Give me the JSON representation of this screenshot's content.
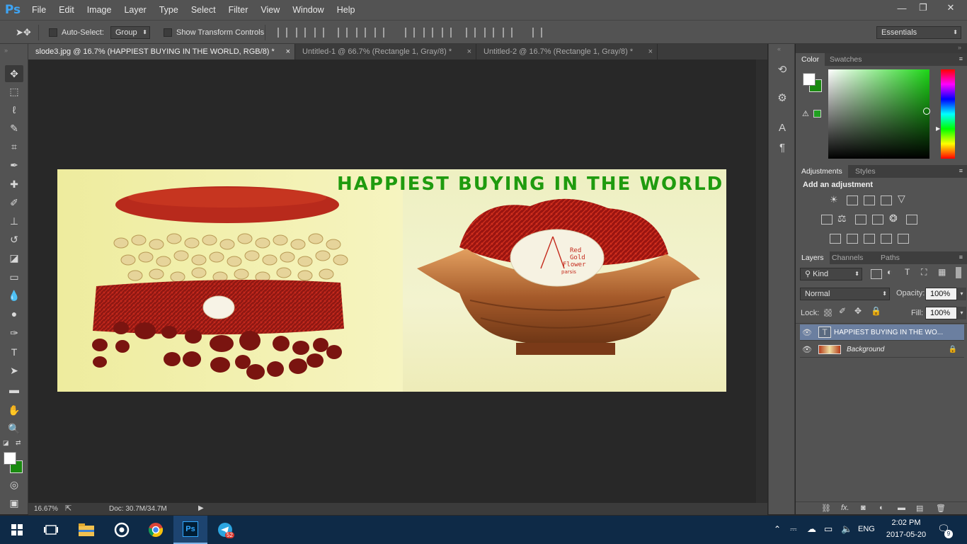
{
  "app": {
    "logo": "Ps"
  },
  "menu": [
    "File",
    "Edit",
    "Image",
    "Layer",
    "Type",
    "Select",
    "Filter",
    "View",
    "Window",
    "Help"
  ],
  "window_controls": {
    "minimize": "—",
    "restore": "❐",
    "close": "✕"
  },
  "options": {
    "auto_select_label": "Auto-Select:",
    "auto_select_value": "Group",
    "transform_label": "Show Transform Controls",
    "workspace": "Essentials"
  },
  "tabs": [
    {
      "label": "slode3.jpg @ 16.7% (HAPPIEST BUYING IN THE WORLD, RGB/8) *",
      "close": "×",
      "active": true
    },
    {
      "label": "Untitled-1 @ 66.7% (Rectangle 1, Gray/8) *",
      "close": "×",
      "active": false
    },
    {
      "label": "Untitled-2 @ 16.7% (Rectangle 1, Gray/8) *",
      "close": "×",
      "active": false
    }
  ],
  "document": {
    "headline": "HAPPIEST BUYING IN THE WORLD",
    "badge_line1": "Red",
    "badge_line2": "Gold",
    "badge_line3": "Flower",
    "badge_line4": "parsis"
  },
  "status": {
    "zoom": "16.67%",
    "doc": "Doc: 30.7M/34.7M"
  },
  "color_panel": {
    "tabs": [
      "Color",
      "Swatches"
    ],
    "foreground": "#ffffff",
    "background": "#1a8a10"
  },
  "adjustments": {
    "tabs": [
      "Adjustments",
      "Styles"
    ],
    "heading": "Add an adjustment"
  },
  "layers_panel": {
    "tabs": [
      "Layers",
      "Channels",
      "Paths"
    ],
    "kind_label": "Kind",
    "blend_mode": "Normal",
    "opacity_label": "Opacity:",
    "opacity_value": "100%",
    "lock_label": "Lock:",
    "fill_label": "Fill:",
    "fill_value": "100%",
    "layers": [
      {
        "name": "HAPPIEST BUYING IN THE WO...",
        "thumb": "T",
        "selected": true
      },
      {
        "name": "Background",
        "thumb": "",
        "selected": false
      }
    ],
    "footer_fx": "fx."
  },
  "taskbar": {
    "language": "ENG",
    "time": "2:02 PM",
    "date": "2017-05-20",
    "telegram_badge": "52",
    "notification_count": "9"
  }
}
